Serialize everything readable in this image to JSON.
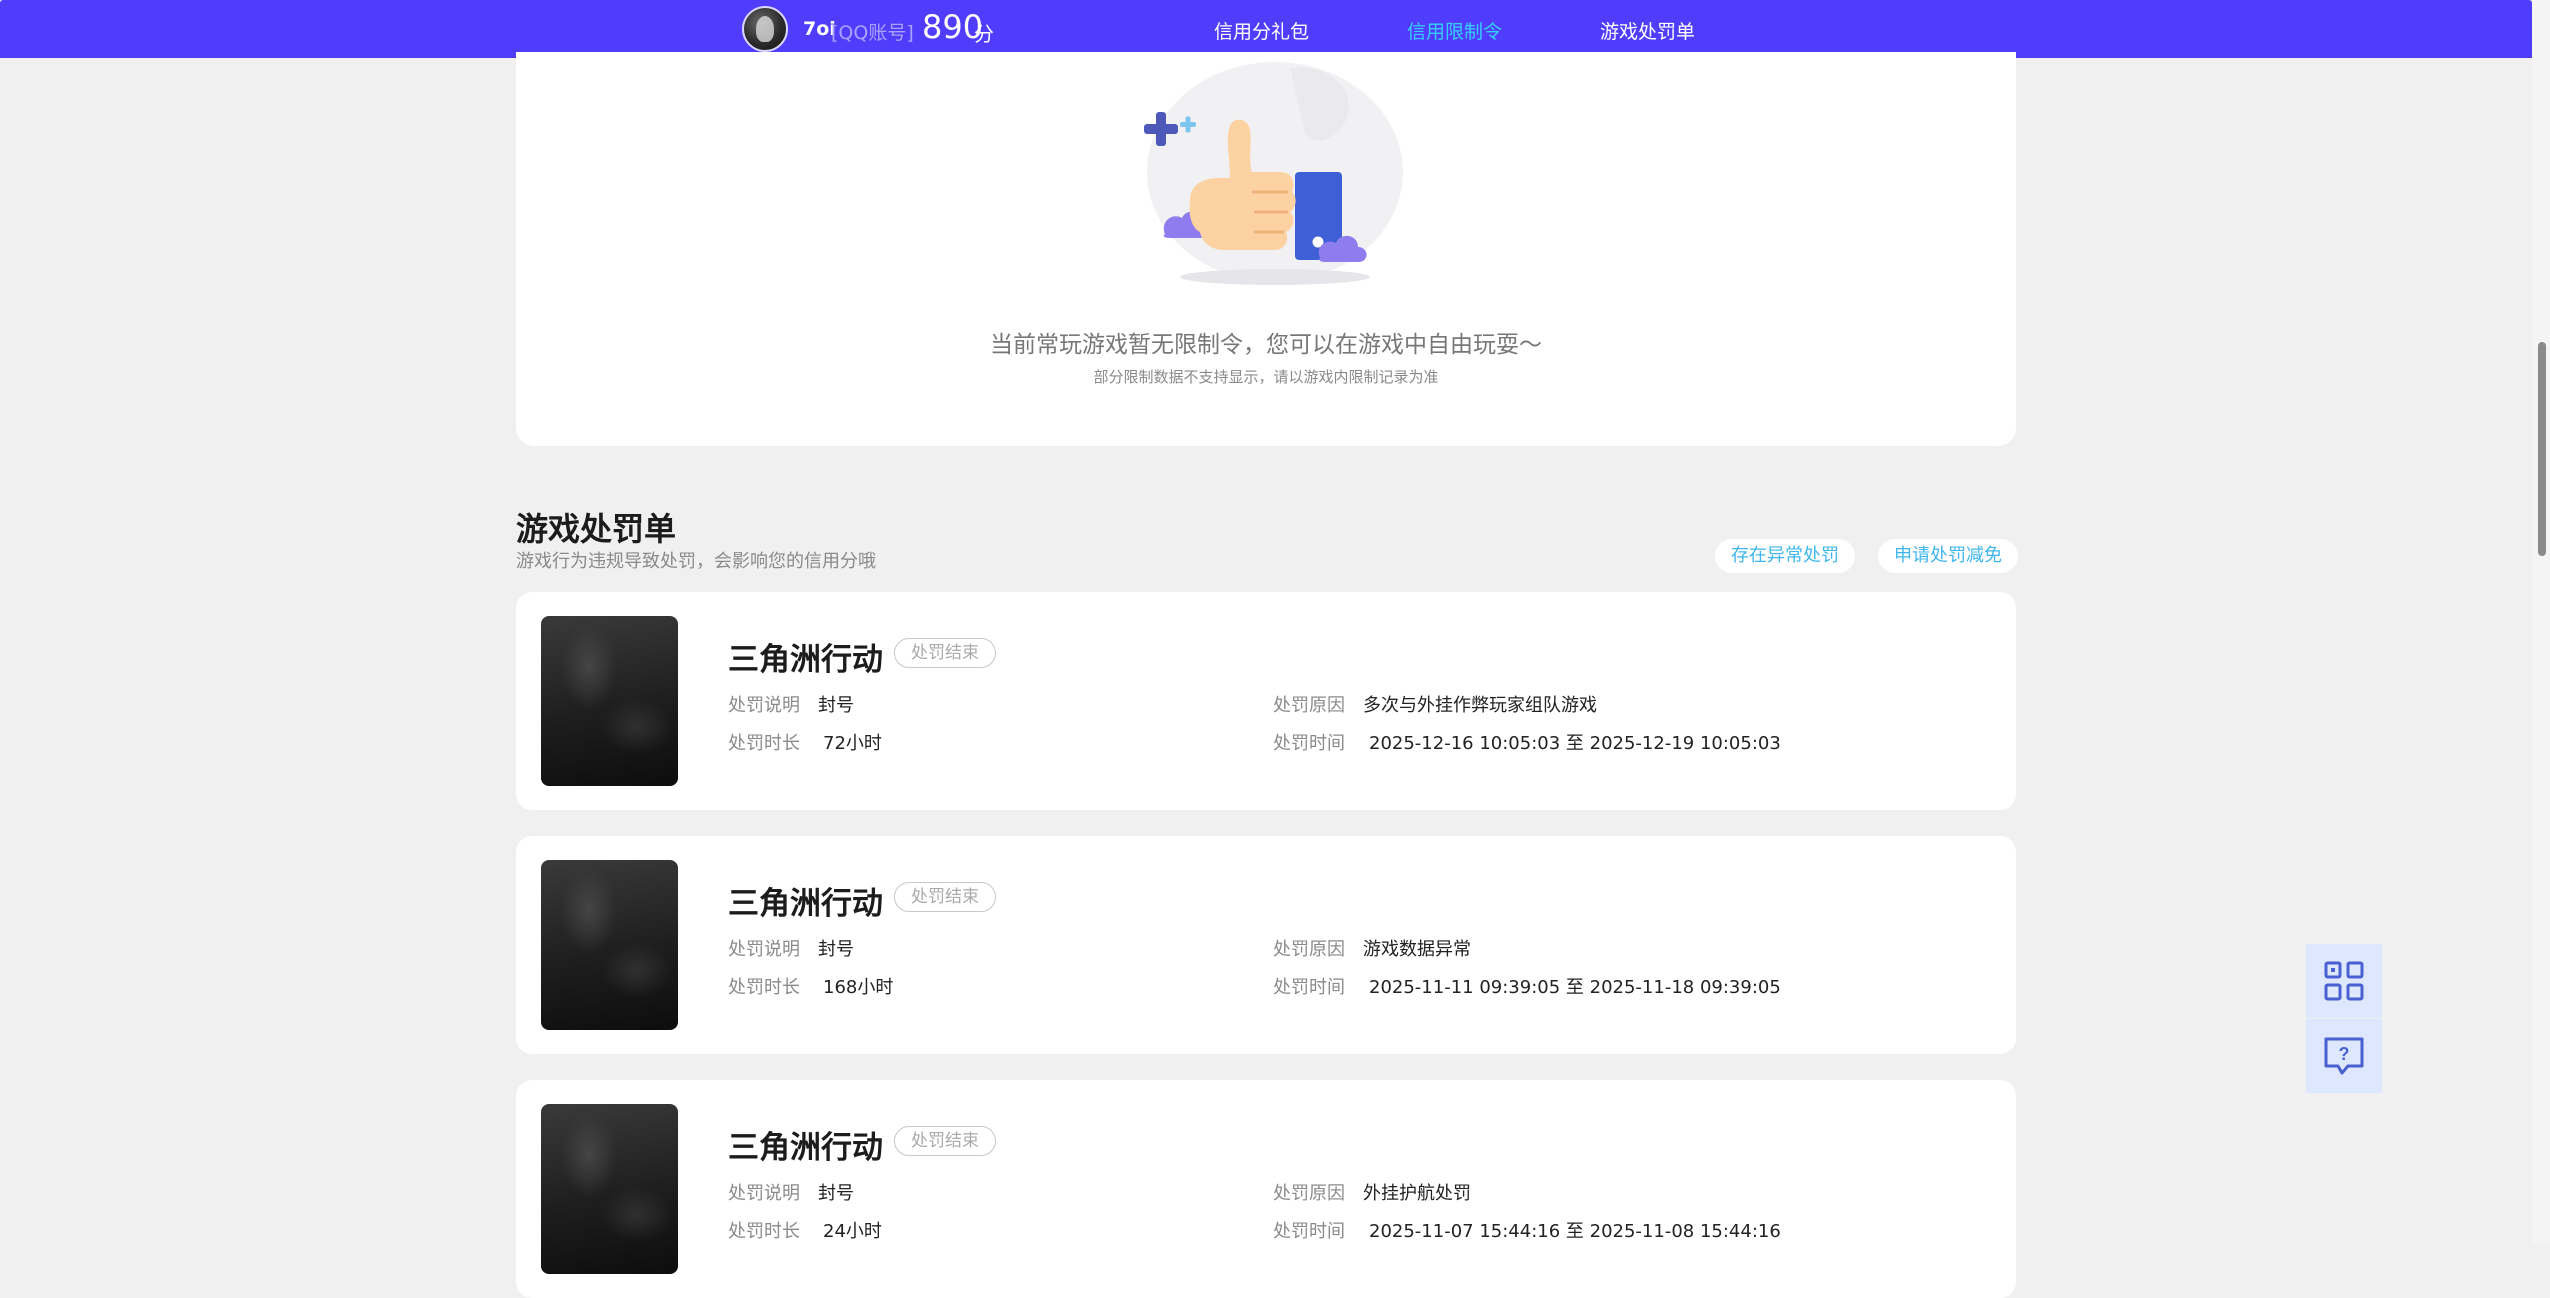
{
  "header": {
    "username": "7oi",
    "account_type": "[QQ账号]",
    "score": "890",
    "score_unit": "分",
    "tabs": [
      {
        "label": "信用分礼包",
        "active": false
      },
      {
        "label": "信用限制令",
        "active": true
      },
      {
        "label": "游戏处罚单",
        "active": false
      }
    ]
  },
  "limit_section": {
    "empty_message": "当前常玩游戏暂无限制令，您可以在游戏中自由玩耍～",
    "empty_note": "部分限制数据不支持显示，请以游戏内限制记录为准"
  },
  "penalty_section": {
    "title": "游戏处罚单",
    "subtitle": "游戏行为违规导致处罚，会影响您的信用分哦",
    "actions": [
      "存在异常处罚",
      "申请处罚减免"
    ],
    "field_labels": {
      "description": "处罚说明",
      "duration": "处罚时长",
      "reason": "处罚原因",
      "time": "处罚时间"
    },
    "records": [
      {
        "game": "三角洲行动",
        "status": "处罚结束",
        "description": "封号",
        "duration": "72小时",
        "reason": "多次与外挂作弊玩家组队游戏",
        "time": "2025-12-16 10:05:03 至 2025-12-19 10:05:03"
      },
      {
        "game": "三角洲行动",
        "status": "处罚结束",
        "description": "封号",
        "duration": "168小时",
        "reason": "游戏数据异常",
        "time": "2025-11-11 09:39:05 至 2025-11-18 09:39:05"
      },
      {
        "game": "三角洲行动",
        "status": "处罚结束",
        "description": "封号",
        "duration": "24小时",
        "reason": "外挂护航处罚",
        "time": "2025-11-07 15:44:16 至 2025-11-08 15:44:16"
      }
    ]
  },
  "floating_tools": [
    "qr-code-icon",
    "help-feedback-icon"
  ],
  "colors": {
    "nav_bg": "#4f3dfb",
    "accent": "#35d0ff",
    "page_bg": "#f0f0f0",
    "pill_text": "#3fb6ef"
  }
}
